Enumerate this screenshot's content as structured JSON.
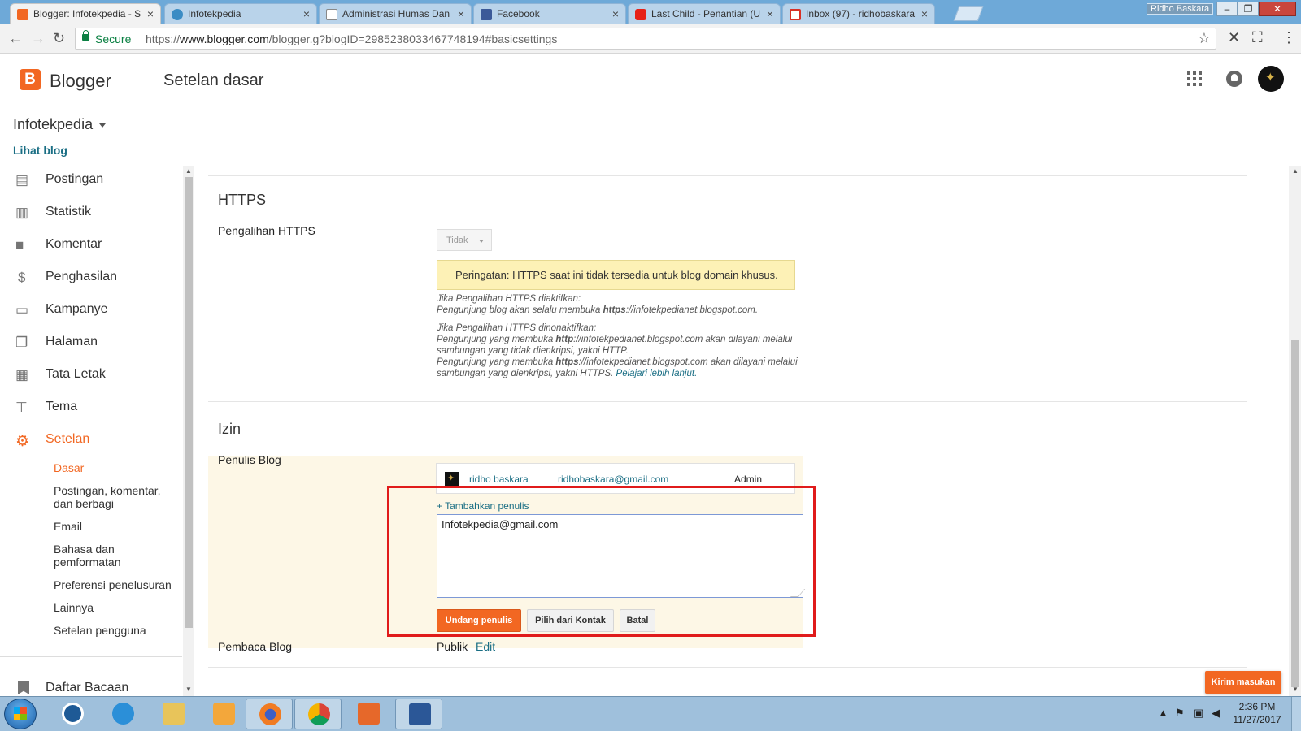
{
  "browser": {
    "tabs": [
      {
        "title": "Blogger: Infotekpedia - S",
        "active": true,
        "icon": "blogger-icon"
      },
      {
        "title": "Infotekpedia",
        "active": false,
        "icon": "globe-icon"
      },
      {
        "title": "Administrasi Humas Dan",
        "active": false,
        "icon": "document-icon"
      },
      {
        "title": "Facebook",
        "active": false,
        "icon": "facebook-icon"
      },
      {
        "title": "Last Child - Penantian (U",
        "active": false,
        "icon": "youtube-icon"
      },
      {
        "title": "Inbox (97) - ridhobaskara",
        "active": false,
        "icon": "gmail-icon"
      }
    ],
    "user_badge": "Ridho Baskara",
    "secure_label": "Secure",
    "url_prefix": "https://",
    "url_host": "www.blogger.com",
    "url_path": "/blogger.g?blogID=2985238033467748194#basicsettings"
  },
  "header": {
    "brand": "Blogger",
    "page_title": "Setelan dasar"
  },
  "sidebar": {
    "blog_name": "Infotekpedia",
    "view_blog": "Lihat blog",
    "items": [
      {
        "label": "Postingan",
        "icon": "posts-icon"
      },
      {
        "label": "Statistik",
        "icon": "stats-icon"
      },
      {
        "label": "Komentar",
        "icon": "comment-icon"
      },
      {
        "label": "Penghasilan",
        "icon": "dollar-icon"
      },
      {
        "label": "Kampanye",
        "icon": "ad-icon"
      },
      {
        "label": "Halaman",
        "icon": "pages-icon"
      },
      {
        "label": "Tata Letak",
        "icon": "layout-icon"
      },
      {
        "label": "Tema",
        "icon": "paint-roller-icon"
      },
      {
        "label": "Setelan",
        "icon": "gear-icon"
      }
    ],
    "subitems": [
      "Dasar",
      "Postingan, komentar, dan berbagi",
      "Email",
      "Bahasa dan pemformatan",
      "Preferensi penelusuran",
      "Lainnya",
      "Setelan pengguna"
    ],
    "reading_list": "Daftar Bacaan"
  },
  "https_section": {
    "title": "HTTPS",
    "redirect_label": "Pengalihan HTTPS",
    "redirect_value": "Tidak",
    "warning": "Peringatan: HTTPS saat ini tidak tersedia untuk blog domain khusus.",
    "help_on_title": "Jika Pengalihan HTTPS diaktifkan:",
    "help_on_a": "Pengunjung blog akan selalu membuka ",
    "help_on_b": "https",
    "help_on_c": "://infotekpedianet.blogspot.com.",
    "help_off_title": "Jika Pengalihan HTTPS dinonaktifkan:",
    "help_off_1a": "Pengunjung yang membuka ",
    "help_off_1b": "http",
    "help_off_1c": "://infotekpedianet.blogspot.com akan dilayani melalui sambungan yang tidak dienkripsi, yakni HTTP.",
    "help_off_2a": "Pengunjung yang membuka ",
    "help_off_2b": "https",
    "help_off_2c": "://infotekpedianet.blogspot.com akan dilayani melalui sambungan yang dienkripsi, yakni HTTPS. ",
    "learn_more": "Pelajari lebih lanjut."
  },
  "permissions": {
    "title": "Izin",
    "authors_label": "Penulis Blog",
    "author": {
      "name": "ridho baskara",
      "email": "ridhobaskara@gmail.com",
      "role": "Admin"
    },
    "add_author": "+ Tambahkan penulis",
    "invite_value": "Infotekpedia@gmail.com",
    "invite_button": "Undang penulis",
    "contacts_button": "Pilih dari Kontak",
    "cancel_button": "Batal",
    "readers_label": "Pembaca Blog",
    "readers_value": "Publik",
    "readers_edit": "Edit"
  },
  "feedback_button": "Kirim masukan",
  "taskbar": {
    "time": "2:36 PM",
    "date": "11/27/2017"
  },
  "colors": {
    "accent": "#f26722",
    "link": "#1a6e84",
    "warning_bg": "#fdf1b6",
    "highlight_box": "#e01b1b"
  }
}
